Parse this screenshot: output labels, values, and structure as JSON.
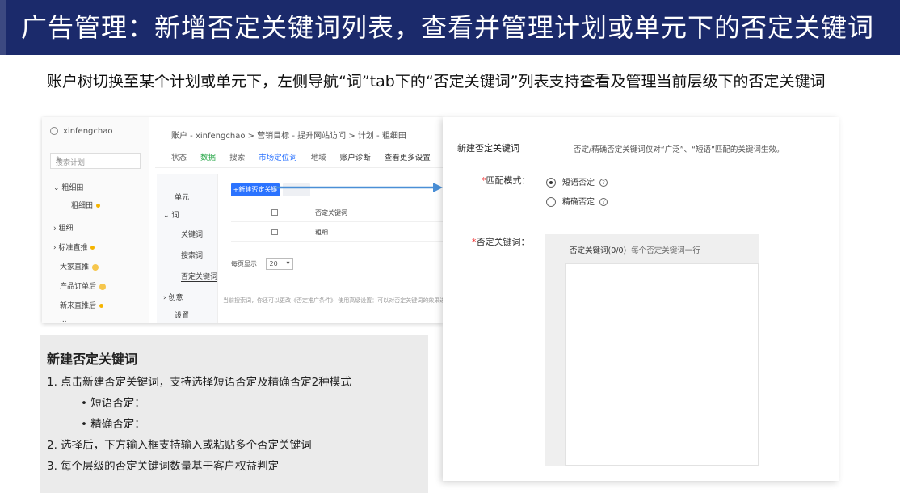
{
  "header": {
    "title": "广告管理：新增否定关键词列表，查看并管理计划或单元下的否定关键词"
  },
  "subtitle": "账户树切换至某个计划或单元下，左侧导航“词”tab下的“否定关键词”列表支持查看及管理当前层级下的否定关键词",
  "screenshot": {
    "tree": {
      "username": "xinfengchao",
      "search_placeholder": "搜索计划",
      "nodes": [
        "粗细田",
        "粗细田",
        "粗细",
        "标准直推",
        "大家直推",
        "产品订单后",
        "新来直推后",
        "..."
      ]
    },
    "breadcrumb": "账户 - xinfengchao > 营销目标 - 提升网站访问 > 计划 - 粗细田",
    "tabs": [
      "状态",
      "数据",
      "搜索",
      "市场定位词",
      "地域",
      "账户诊断",
      "查看更多设置"
    ],
    "side_nav": {
      "unit": "单元",
      "word_group": "词",
      "keyword": "关键词",
      "search_word": "搜索词",
      "negative_keyword": "否定关键词",
      "creative": "创意",
      "settings": "设置"
    },
    "list": {
      "new_button": "+新建否定关键词",
      "header_text": "否定关键词",
      "row_text": "粗细",
      "page_size_label": "每页显示",
      "page_size": "20"
    },
    "footer_hint": "当前搜索词，你还可以更改《否定推广条件》 使用高级设置：可以对否定关键词的效果进行分析"
  },
  "notes": {
    "title": "新建否定关键词",
    "item1": "1.  点击新建否定关键词，支持选择短语否定及精确否定2种模式",
    "bullet1": "•    短语否定：",
    "bullet2": "•    精确否定：",
    "item2": "2.  选择后，下方输入框支持输入或粘贴多个否定关键词",
    "item3": "3.  每个层级的否定关键词数量基于客户权益判定"
  },
  "dialog": {
    "title": "新建否定关键词",
    "hint": "否定/精确否定关键词仅对“广泛”、“短语”匹配的关键词生效。",
    "match_label": "匹配模式：",
    "option_phrase": "短语否定",
    "option_exact": "精确否定",
    "keyword_label": "否定关键词：",
    "box_title": "否定关键词(0/0)",
    "box_hint": "每个否定关键词一行"
  }
}
